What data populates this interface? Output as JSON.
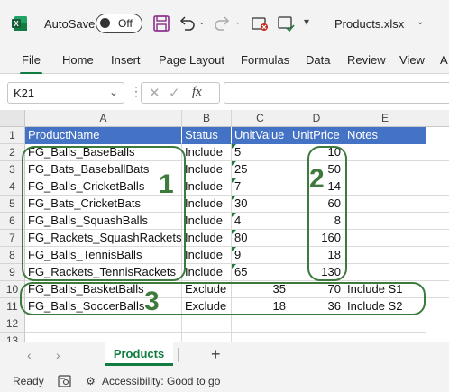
{
  "titlebar": {
    "autosave_label": "AutoSave",
    "autosave_state": "Off",
    "filename": "Products.xlsx"
  },
  "ribbon": {
    "tabs": [
      "File",
      "Home",
      "Insert",
      "Page Layout",
      "Formulas",
      "Data",
      "Review",
      "View",
      "A"
    ]
  },
  "formula_bar": {
    "name_box": "K21",
    "fx": "fx",
    "formula": ""
  },
  "grid": {
    "columns": [
      "A",
      "B",
      "C",
      "D",
      "E"
    ],
    "row_numbers": [
      "1",
      "2",
      "3",
      "4",
      "5",
      "6",
      "7",
      "8",
      "9",
      "10",
      "11",
      "12",
      "13"
    ],
    "header": [
      "ProductName",
      "Status",
      "UnitValue",
      "UnitPrice",
      "Notes"
    ],
    "rows": [
      [
        "FG_Balls_BaseBalls",
        "Include",
        "5",
        "10",
        ""
      ],
      [
        "FG_Bats_BaseballBats",
        "Include",
        "25",
        "50",
        ""
      ],
      [
        "FG_Balls_CricketBalls",
        "Include",
        "7",
        "14",
        ""
      ],
      [
        "FG_Bats_CricketBats",
        "Include",
        "30",
        "60",
        ""
      ],
      [
        "FG_Balls_SquashBalls",
        "Include",
        "4",
        "8",
        ""
      ],
      [
        "FG_Rackets_SquashRackets",
        "Include",
        "80",
        "160",
        ""
      ],
      [
        "FG_Balls_TennisBalls",
        "Include",
        "9",
        "18",
        ""
      ],
      [
        "FG_Rackets_TennisRackets",
        "Include",
        "65",
        "130",
        ""
      ],
      [
        "FG_Balls_BasketBalls",
        "Exclude",
        "35",
        "70",
        "Include S1"
      ],
      [
        "FG_Balls_SoccerBalls",
        "Exclude",
        "18",
        "36",
        "Include S2"
      ]
    ],
    "annotations": [
      "1",
      "2",
      "3"
    ]
  },
  "sheets": {
    "active": "Products",
    "add": "+"
  },
  "status": {
    "ready": "Ready",
    "accessibility": "Accessibility: Good to go"
  },
  "colors": {
    "excel_green": "#107c41",
    "header_blue": "#4472c4",
    "annotation_green": "#3e7a3c"
  }
}
